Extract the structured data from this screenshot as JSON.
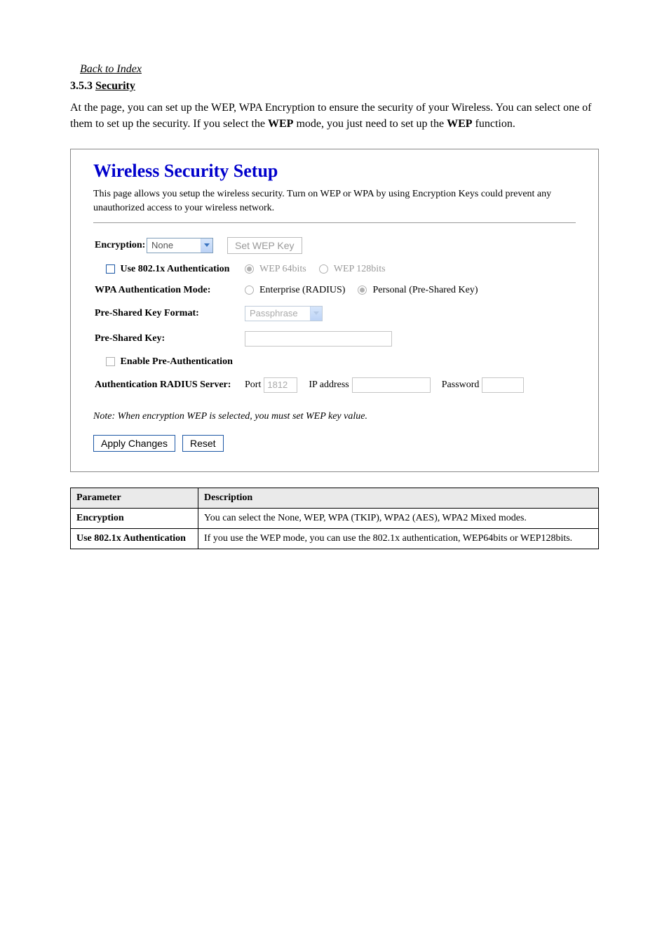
{
  "anchor_text": "Back to Index",
  "section_number": "3.5.3",
  "section_title": "Security",
  "top_desc_before": "At the page, you can set up the WEP, WPA Encryption to ensure the security of your Wireless. You can select one of them to set up the security. If you select the ",
  "top_desc_bold1": "WEP",
  "top_desc_mid": " mode, you just need to set up the ",
  "top_desc_bold2": "WEP",
  "top_desc_after": " function.",
  "panel": {
    "title": "Wireless Security Setup",
    "intro": "This page allows you setup the wireless security. Turn on WEP or WPA by using Encryption Keys could prevent any unauthorized access to your wireless network.",
    "labels": {
      "encryption": "Encryption:",
      "use8021x": "Use 802.1x Authentication",
      "wpa_mode": "WPA Authentication Mode:",
      "psk_format": "Pre-Shared Key Format:",
      "psk": "Pre-Shared Key:",
      "preauth": "Enable Pre-Authentication",
      "radius": "Authentication RADIUS Server:"
    },
    "encryption_value": "None",
    "setwep_btn": "Set WEP Key",
    "wep64": "WEP 64bits",
    "wep128": "WEP 128bits",
    "enterprise": "Enterprise (RADIUS)",
    "personal": "Personal (Pre-Shared Key)",
    "passphrase": "Passphrase",
    "port_label": "Port",
    "port_value": "1812",
    "ip_label": "IP address",
    "pwd_label": "Password",
    "note": "Note: When encryption WEP is selected, you must set WEP key value.",
    "apply": "Apply Changes",
    "reset": "Reset"
  },
  "table": {
    "h1": "Parameter",
    "h2": "Description",
    "r1c1": "Encryption",
    "r1c2": "You can select the None, WEP, WPA (TKIP), WPA2 (AES), WPA2 Mixed modes.",
    "r2c1": "Use 802.1x Authentication",
    "r2c2": "If you use the WEP mode, you can use the 802.1x authentication, WEP64bits or WEP128bits."
  }
}
